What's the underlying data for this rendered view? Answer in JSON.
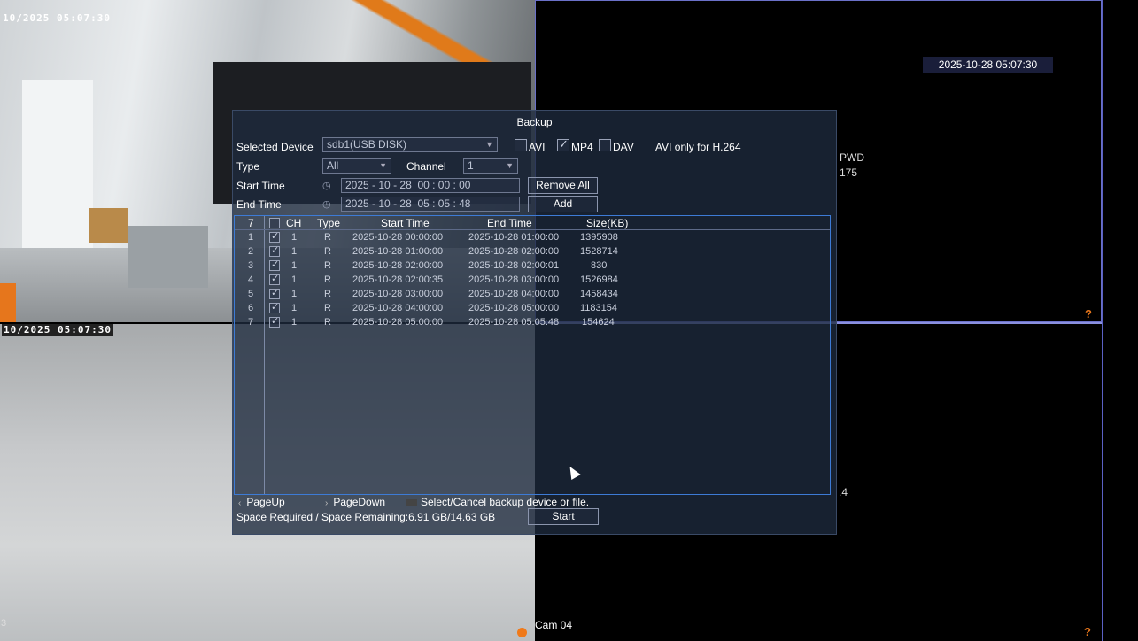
{
  "cams": {
    "cam1_osd": "10/2025 05:07:30",
    "cam2_osd": "10/2025  05:07:30",
    "cam3_timestamp": "2025-10-28 05:07:30",
    "cam3_side_text_1": "PWD",
    "cam3_side_text_2": "175",
    "cam4_side_text": ".4",
    "cam4_label": "Cam 04",
    "cam2_edge_num": "3",
    "help_glyph": "?"
  },
  "dialog": {
    "title": "Backup",
    "selected_device_label": "Selected Device",
    "selected_device_value": "sdb1(USB DISK)",
    "avi_label": "AVI",
    "mp4_label": "MP4",
    "dav_label": "DAV",
    "avi_note": "AVI only for H.264",
    "type_label": "Type",
    "type_value": "All",
    "channel_label": "Channel",
    "channel_value": "1",
    "start_time_label": "Start Time",
    "start_time": {
      "year": "2025",
      "month": "10",
      "day": "28",
      "time": "00 : 00 : 00"
    },
    "end_time_label": "End Time",
    "end_time": {
      "year": "2025",
      "month": "10",
      "day": "28",
      "time": "05 : 05 : 48"
    },
    "remove_all_label": "Remove All",
    "add_label": "Add",
    "list": {
      "header_count": "7",
      "headers": {
        "ch": "CH",
        "type": "Type",
        "start": "Start Time",
        "end": "End Time",
        "size": "Size(KB)"
      },
      "rows": [
        {
          "idx": "1",
          "ch": "1",
          "type": "R",
          "start": "2025-10-28 00:00:00",
          "end": "2025-10-28 01:00:00",
          "size": "1395908"
        },
        {
          "idx": "2",
          "ch": "1",
          "type": "R",
          "start": "2025-10-28 01:00:00",
          "end": "2025-10-28 02:00:00",
          "size": "1528714"
        },
        {
          "idx": "3",
          "ch": "1",
          "type": "R",
          "start": "2025-10-28 02:00:00",
          "end": "2025-10-28 02:00:01",
          "size": "830"
        },
        {
          "idx": "4",
          "ch": "1",
          "type": "R",
          "start": "2025-10-28 02:00:35",
          "end": "2025-10-28 03:00:00",
          "size": "1526984"
        },
        {
          "idx": "5",
          "ch": "1",
          "type": "R",
          "start": "2025-10-28 03:00:00",
          "end": "2025-10-28 04:00:00",
          "size": "1458434"
        },
        {
          "idx": "6",
          "ch": "1",
          "type": "R",
          "start": "2025-10-28 04:00:00",
          "end": "2025-10-28 05:00:00",
          "size": "1183154"
        },
        {
          "idx": "7",
          "ch": "1",
          "type": "R",
          "start": "2025-10-28 05:00:00",
          "end": "2025-10-28 05:05:48",
          "size": "154624"
        }
      ]
    },
    "page_up_label": "PageUp",
    "page_down_label": "PageDown",
    "hint": "Select/Cancel backup device or file.",
    "space_text": "Space Required / Space Remaining:6.91 GB/14.63 GB",
    "start_label": "Start"
  }
}
